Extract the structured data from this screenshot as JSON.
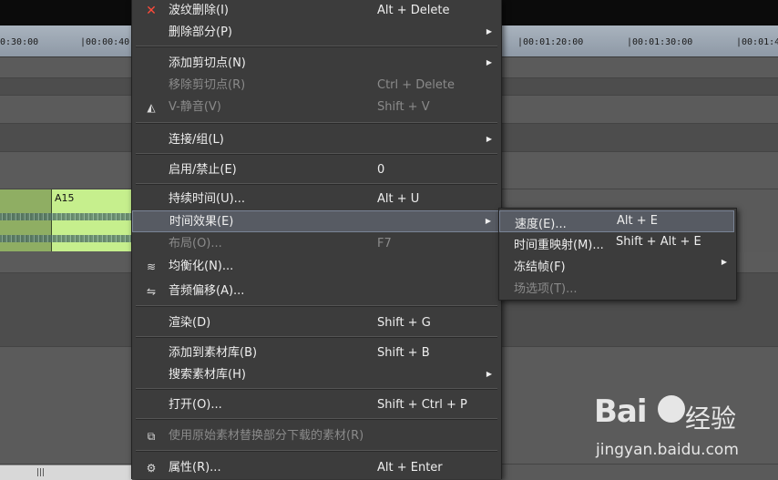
{
  "ruler": {
    "ticks": [
      "0:30:00",
      "|00:00:40",
      "|00:01:20:00",
      "|00:01:30:00",
      "|00:01:4"
    ]
  },
  "clip": {
    "label": "A15"
  },
  "context_menu": {
    "items": [
      {
        "icon": "close-icon",
        "label": "波纹删除(I)",
        "shortcut": "Alt + Delete",
        "enabled": true,
        "submenu": false
      },
      {
        "label": "删除部分(P)",
        "shortcut": "",
        "enabled": true,
        "submenu": true
      },
      {
        "label": "添加剪切点(N)",
        "shortcut": "",
        "enabled": true,
        "submenu": true
      },
      {
        "label": "移除剪切点(R)",
        "shortcut": "Ctrl + Delete",
        "enabled": false,
        "submenu": false
      },
      {
        "icon": "mute-icon",
        "label": "V-静音(V)",
        "shortcut": "Shift + V",
        "enabled": false,
        "submenu": false
      },
      {
        "label": "连接/组(L)",
        "shortcut": "",
        "enabled": true,
        "submenu": true
      },
      {
        "label": "启用/禁止(E)",
        "shortcut": "0",
        "enabled": true,
        "submenu": false
      },
      {
        "label": "持续时间(U)...",
        "shortcut": "Alt + U",
        "enabled": true,
        "submenu": false
      },
      {
        "label": "时间效果(E)",
        "shortcut": "",
        "enabled": true,
        "submenu": true,
        "highlighted": true
      },
      {
        "label": "布局(O)...",
        "shortcut": "F7",
        "enabled": false,
        "submenu": false
      },
      {
        "icon": "equalizer-icon",
        "label": "均衡化(N)...",
        "shortcut": "",
        "enabled": true,
        "submenu": false
      },
      {
        "icon": "audio-shift-icon",
        "label": "音频偏移(A)...",
        "shortcut": "",
        "enabled": true,
        "submenu": false
      },
      {
        "label": "渲染(D)",
        "shortcut": "Shift + G",
        "enabled": true,
        "submenu": false
      },
      {
        "label": "添加到素材库(B)",
        "shortcut": "Shift + B",
        "enabled": true,
        "submenu": false
      },
      {
        "label": "搜索素材库(H)",
        "shortcut": "",
        "enabled": true,
        "submenu": true
      },
      {
        "label": "打开(O)...",
        "shortcut": "Shift + Ctrl + P",
        "enabled": true,
        "submenu": false
      },
      {
        "icon": "replace-icon",
        "label": "使用原始素材替换部分下载的素材(R)",
        "shortcut": "",
        "enabled": false,
        "submenu": false
      },
      {
        "icon": "properties-icon",
        "label": "属性(R)...",
        "shortcut": "Alt + Enter",
        "enabled": true,
        "submenu": false
      }
    ]
  },
  "submenu": {
    "items": [
      {
        "label": "速度(E)...",
        "shortcut": "Alt + E",
        "enabled": true,
        "submenu": false,
        "highlighted": true
      },
      {
        "label": "时间重映射(M)...",
        "shortcut": "Shift + Alt + E",
        "enabled": true,
        "submenu": false
      },
      {
        "label": "冻结帧(F)",
        "shortcut": "",
        "enabled": true,
        "submenu": true
      },
      {
        "label": "场选项(T)...",
        "shortcut": "",
        "enabled": false,
        "submenu": false
      }
    ]
  },
  "watermark": {
    "brand": "Bai",
    "brand_suffix": "经验",
    "url": "jingyan.baidu.com"
  },
  "scrollbar": {
    "grip": "|||"
  },
  "colors": {
    "menu_bg": "#3c3c3c",
    "highlight": "#575b63",
    "clip_green": "#c6ef8d",
    "ruler": "#a9b3be"
  }
}
